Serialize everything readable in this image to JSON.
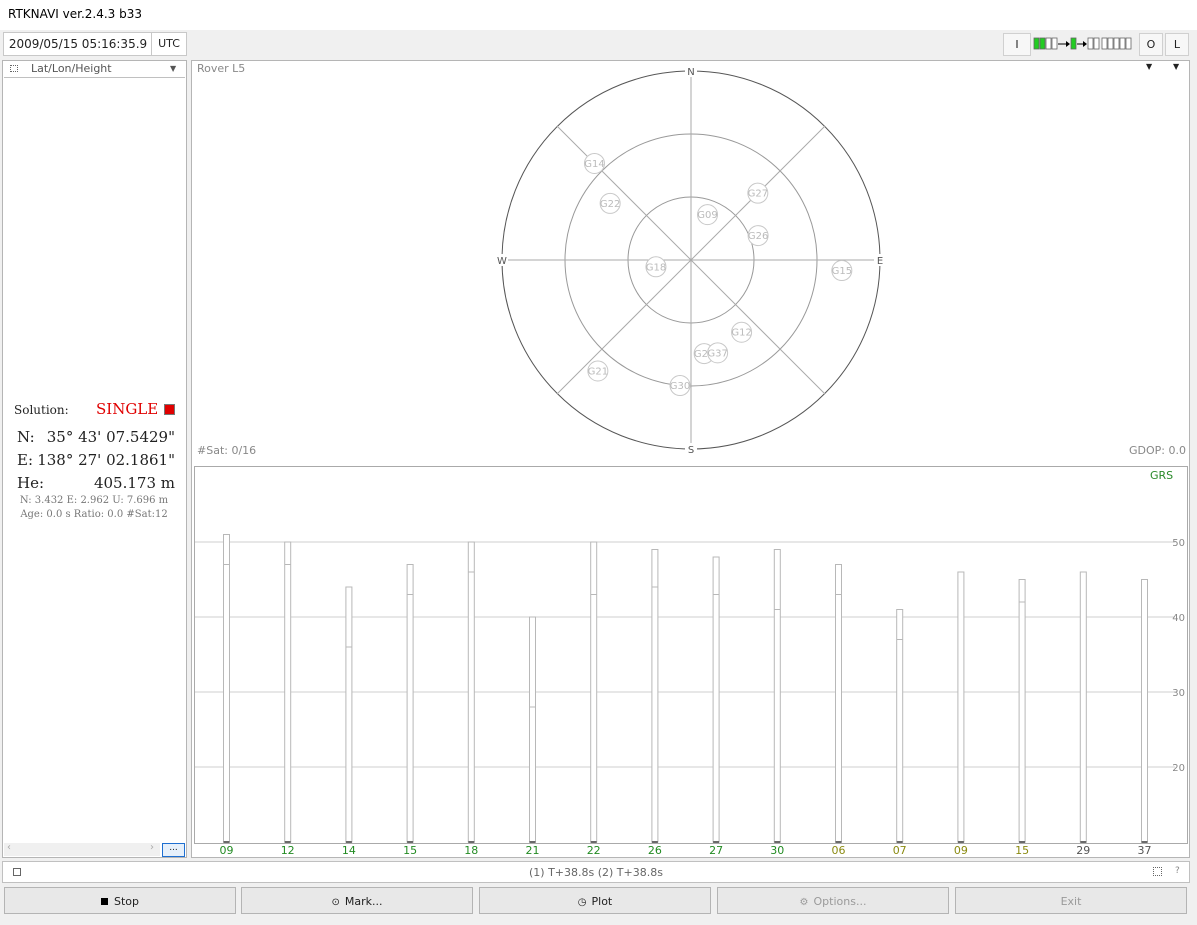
{
  "window": {
    "title": "RTKNAVI ver.2.4.3 b33"
  },
  "toolbar": {
    "time": "2009/05/15 05:16:35.9",
    "time_system": "UTC",
    "input_label": "I",
    "output_label": "O",
    "log_label": "L"
  },
  "solution_panel": {
    "display_mode": "Lat/Lon/Height",
    "solution_label": "Solution:",
    "solution_status": "SINGLE",
    "status_color": "#e00000",
    "n_label": "N:",
    "n_value": "35° 43' 07.5429\"",
    "e_label": "E:",
    "e_value": "138° 27' 02.1861\"",
    "h_label": "He:",
    "h_value": "405.173 m",
    "std_line": "N: 3.432 E: 2.962 U: 7.696 m",
    "age_line": "Age: 0.0 s Ratio: 0.0 #Sat:12",
    "more_button": "..."
  },
  "skyplot": {
    "title": "Rover L5",
    "compass": {
      "n": "N",
      "e": "E",
      "s": "S",
      "w": "W"
    },
    "nsat": "#Sat: 0/16",
    "gdop": "GDOP: 0.0",
    "satellites": [
      {
        "id": "G14",
        "az": 315,
        "el": 25
      },
      {
        "id": "G22",
        "az": 305,
        "el": 43
      },
      {
        "id": "G09",
        "az": 20,
        "el": 67
      },
      {
        "id": "G27",
        "az": 45,
        "el": 45
      },
      {
        "id": "G26",
        "az": 70,
        "el": 56
      },
      {
        "id": "G18",
        "az": 259,
        "el": 73
      },
      {
        "id": "G15",
        "az": 94,
        "el": 18
      },
      {
        "id": "G12",
        "az": 145,
        "el": 48
      },
      {
        "id": "G29",
        "az": 172,
        "el": 45
      },
      {
        "id": "G37",
        "az": 164,
        "el": 44
      },
      {
        "id": "G30",
        "az": 185,
        "el": 30
      },
      {
        "id": "G21",
        "az": 220,
        "el": 21
      }
    ]
  },
  "snr_chart": {
    "legend": "GRS",
    "legend_color": "#2a8a2a"
  },
  "chart_data": {
    "type": "bar",
    "title": "",
    "ylabel": "",
    "ylim": [
      10,
      60
    ],
    "yticks": [
      20,
      30,
      40,
      50
    ],
    "categories": [
      "09",
      "12",
      "14",
      "15",
      "18",
      "21",
      "22",
      "26",
      "27",
      "30",
      "06",
      "07",
      "09",
      "15",
      "29",
      "37"
    ],
    "category_colors": [
      "#228b22",
      "#228b22",
      "#228b22",
      "#228b22",
      "#228b22",
      "#228b22",
      "#228b22",
      "#228b22",
      "#228b22",
      "#228b22",
      "#8a8a10",
      "#8a8a10",
      "#8a8a10",
      "#8a8a10",
      "#555555",
      "#555555"
    ],
    "series": [
      {
        "name": "",
        "values": [
          51,
          50,
          44,
          47,
          50,
          40,
          50,
          49,
          48,
          49,
          47,
          41,
          46,
          45,
          46,
          45
        ]
      },
      {
        "name": "",
        "values": [
          47,
          47,
          36,
          43,
          46,
          28,
          43,
          44,
          43,
          41,
          43,
          37,
          null,
          42,
          null,
          null
        ]
      }
    ]
  },
  "status_bar": {
    "text": "(1) T+38.8s (2) T+38.8s",
    "help": "?"
  },
  "buttons": {
    "stop": "Stop",
    "mark": "Mark...",
    "plot": "Plot",
    "options": "Options...",
    "exit": "Exit"
  }
}
